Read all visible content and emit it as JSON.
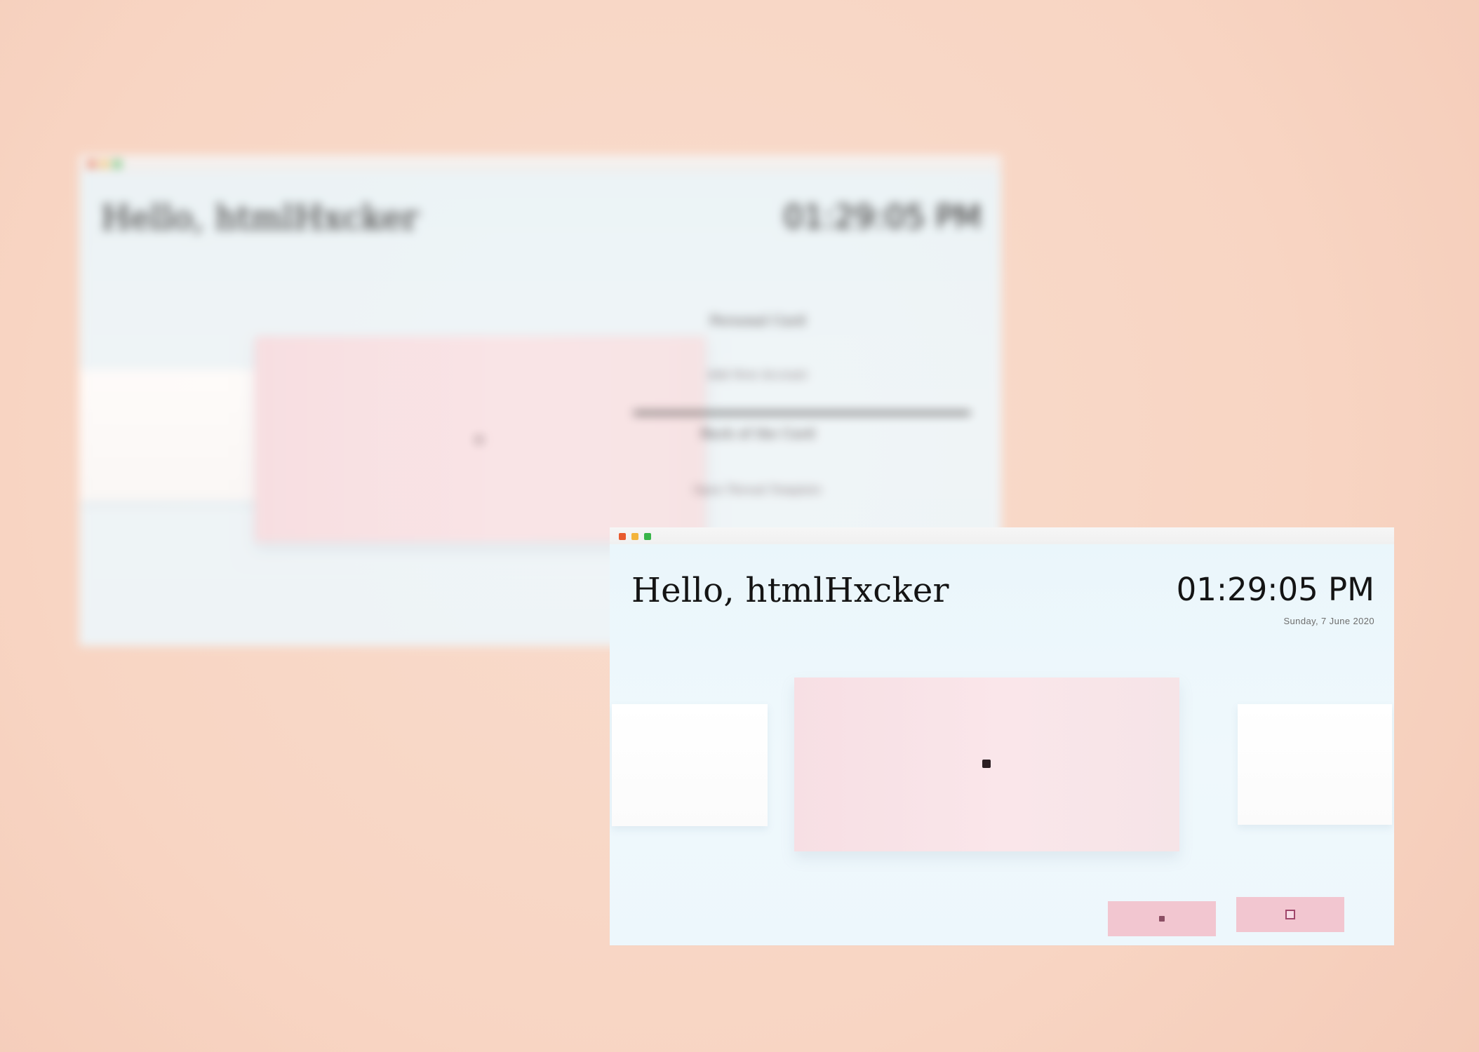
{
  "colors": {
    "background": "#f8d5c3",
    "window": "#eef8fc",
    "card_pink": "#f7dfe4",
    "button_pink": "#f2c6d0",
    "text_dark": "#141414"
  },
  "back_window": {
    "greeting": "Hello, htmlHxcker",
    "clock": "01:29:05 PM",
    "menu_items": [
      "Personal Card",
      "Add New Account",
      "Back of the Card",
      "Open Thread Template"
    ]
  },
  "front_window": {
    "greeting": "Hello, htmlHxcker",
    "clock": "01:29:05 PM",
    "subtitle": "Sunday, 7 June 2020",
    "buttons": [
      {
        "icon": "square-icon"
      },
      {
        "icon": "document-icon"
      }
    ]
  }
}
